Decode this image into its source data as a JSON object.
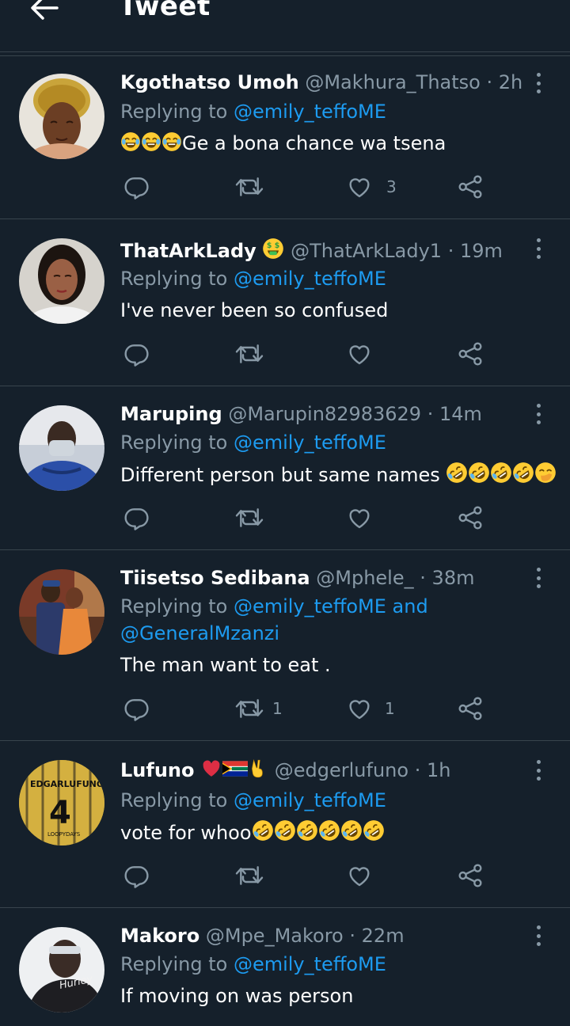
{
  "header": {
    "title": "Tweet"
  },
  "tweets": [
    {
      "name": "Kgothatso Umoh",
      "handle": "@Makhura_Thatso",
      "time": "2h",
      "reply_label": "Replying to",
      "mentions": "@emily_teffoME",
      "text": "Ge a bona chance wa tsena",
      "reply_count": "",
      "retweet_count": "",
      "like_count": "3"
    },
    {
      "name": "ThatArkLady",
      "handle": "@ThatArkLady1",
      "time": "19m",
      "reply_label": "Replying to",
      "mentions": "@emily_teffoME",
      "text": "I've never been so confused",
      "reply_count": "",
      "retweet_count": "",
      "like_count": ""
    },
    {
      "name": "Maruping",
      "handle": "@Marupin82983629",
      "time": "14m",
      "reply_label": "Replying to",
      "mentions": "@emily_teffoME",
      "text": "Different person but same names",
      "reply_count": "",
      "retweet_count": "",
      "like_count": ""
    },
    {
      "name": "Tiisetso Sedibana",
      "handle": "@Mphele_",
      "time": "38m",
      "reply_label": "Replying to",
      "mentions": "@emily_teffoME and",
      "mentions2": "@GeneralMzanzi",
      "text": "The man want to eat .",
      "reply_count": "",
      "retweet_count": "1",
      "like_count": "1"
    },
    {
      "name": "Lufuno",
      "handle": "@edgerlufuno",
      "time": "1h",
      "reply_label": "Replying to",
      "mentions": "@emily_teffoME",
      "text": "vote for whoo",
      "reply_count": "",
      "retweet_count": "",
      "like_count": ""
    },
    {
      "name": "Makoro",
      "handle": "@Mpe_Makoro",
      "time": "22m",
      "reply_label": "Replying to",
      "mentions": "@emily_teffoME",
      "text": "If moving on was person"
    }
  ],
  "separator": "·",
  "colors": {
    "background": "#15202b",
    "secondary_text": "#8899a6",
    "link": "#1d9bf0",
    "divider": "#38444d"
  },
  "icons": [
    "back-arrow-icon",
    "more-icon",
    "reply-icon",
    "retweet-icon",
    "like-icon",
    "share-icon",
    "joy-emoji-icon",
    "money-mouth-emoji-icon",
    "rofl-emoji-icon",
    "hand-over-mouth-emoji-icon",
    "heart-emoji-icon",
    "south-africa-flag-icon",
    "victory-hand-icon"
  ]
}
